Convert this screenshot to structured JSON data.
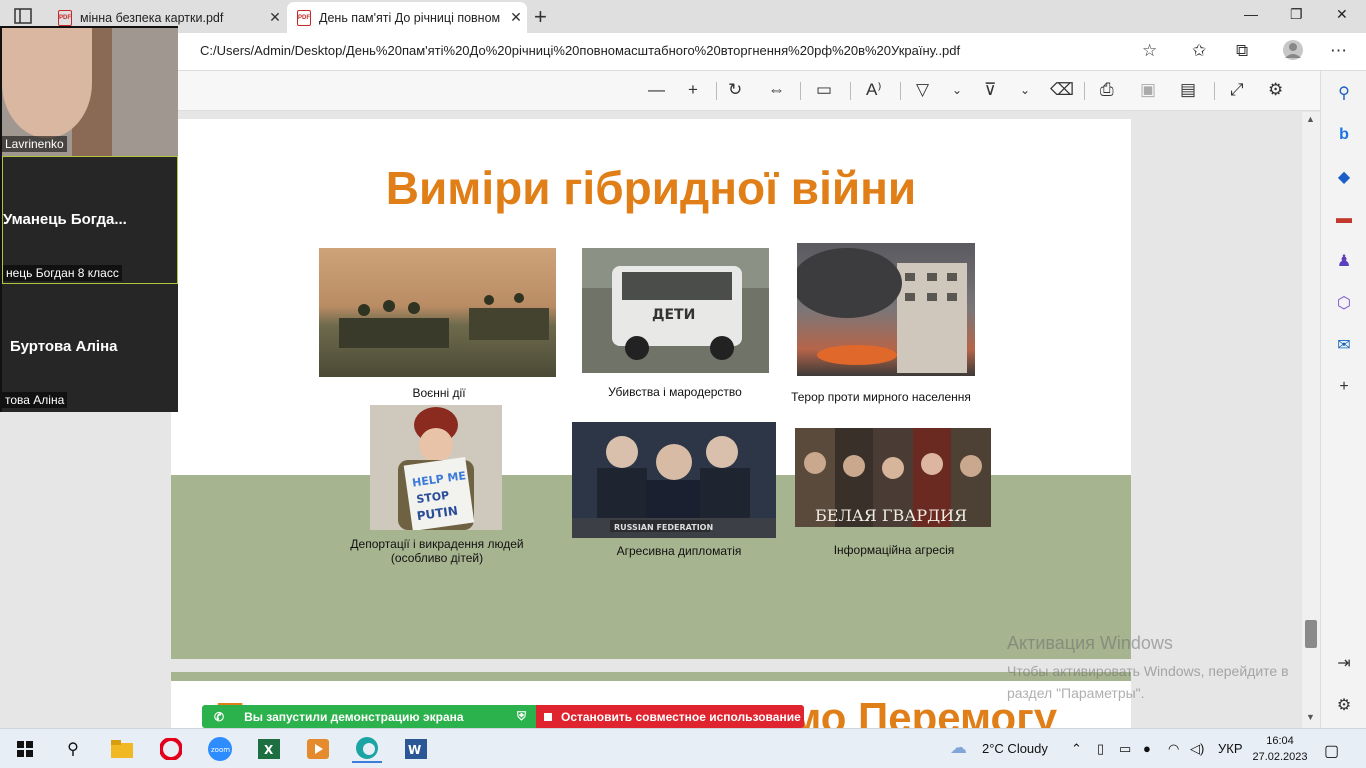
{
  "browser": {
    "tabs": [
      {
        "title": "мінна безпека картки.pdf",
        "active": false
      },
      {
        "title": "День пам'яті До річниці повном",
        "active": true
      }
    ],
    "address": "C:/Users/Admin/Desktop/День%20пам'яті%20До%20річниці%20повномасштабного%20вторгнення%20рф%20в%20Україну..pdf"
  },
  "slide": {
    "title": "Виміри гібридної війни",
    "captions": {
      "military": "Воєнні дії",
      "killings": "Убивства і мародерство",
      "terror": "Терор проти мирного населення",
      "deportation": "Депортації і викрадення людей (особливо дітей)",
      "diplomacy": "Агресивна дипломатія",
      "info": "Інформаційна агресія"
    },
    "photo_texts": {
      "van": "ДЕТИ",
      "sign": "HELP ME STOP PUTIN",
      "un_plate": "RUSSIAN FEDERATION",
      "poster": "БЕЛАЯ ГВАРДИЯ"
    }
  },
  "next_slide": {
    "title_left": "П",
    "title_right": "мо Перемогу"
  },
  "watermark": {
    "title": "Активация Windows",
    "line1": "Чтобы активировать Windows, перейдите в",
    "line2": "раздел \"Параметры\"."
  },
  "zoom": {
    "participants": [
      {
        "tag": "Lavrinenko"
      },
      {
        "name": "Уманець Богда...",
        "tag": "нець Богдан 8 класс"
      },
      {
        "name": "Буртова Аліна",
        "tag": "това Аліна"
      }
    ],
    "share_text": "Вы запустили демонстрацию экрана",
    "stop_text": "Остановить совместное использование"
  },
  "taskbar": {
    "weather": "2°C  Cloudy",
    "lang": "УКР",
    "time": "16:04",
    "date": "27.02.2023"
  },
  "colors": {
    "title": "#e07e17",
    "band": "#a7b490",
    "zoom_active": "#b2c33c"
  }
}
